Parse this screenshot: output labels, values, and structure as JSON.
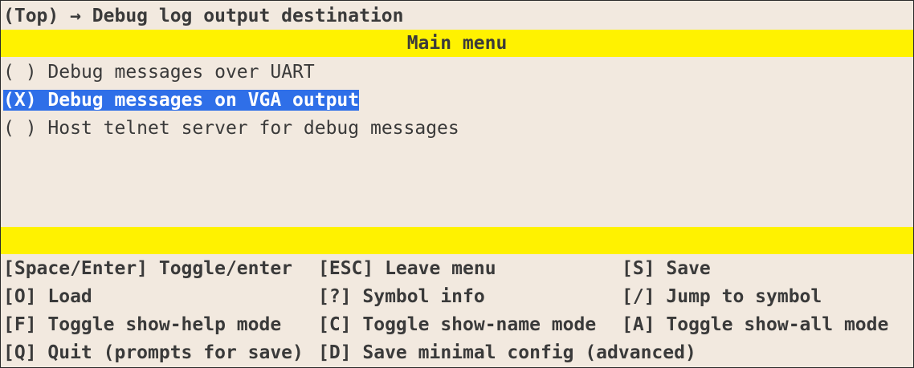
{
  "header": {
    "path": "(Top) → Debug log output destination"
  },
  "menu": {
    "title": "Main menu",
    "items": [
      {
        "radio": "( )",
        "label": "Debug messages over UART",
        "selected": false
      },
      {
        "radio": "(X)",
        "label": "Debug messages on VGA output",
        "selected": true
      },
      {
        "radio": "( )",
        "label": "Host telnet server for debug messages",
        "selected": false
      }
    ]
  },
  "help": [
    [
      "[Space/Enter] Toggle/enter",
      "[ESC] Leave menu",
      "[S] Save"
    ],
    [
      "[O] Load",
      "[?] Symbol info",
      "[/] Jump to symbol"
    ],
    [
      "[F] Toggle show-help mode",
      "[C] Toggle show-name mode",
      "[A] Toggle show-all mode"
    ],
    [
      "[Q] Quit (prompts for save)",
      "[D] Save minimal config (advanced)",
      ""
    ]
  ],
  "colors": {
    "background": "#f2e9df",
    "bar": "#fff200",
    "selection": "#2f6fe8",
    "text": "#3a3a3a"
  }
}
